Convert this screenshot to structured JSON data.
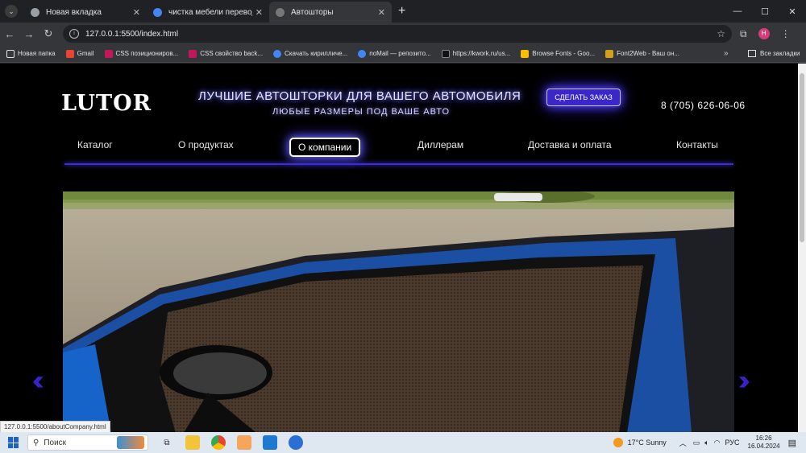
{
  "browser": {
    "tabs": [
      {
        "title": "Новая вкладка",
        "fav_color": "#aaaaaa",
        "active": false
      },
      {
        "title": "чистка мебели перевод - Пои",
        "fav_color": "#4285f4",
        "active": false
      },
      {
        "title": "Автошторы",
        "fav_color": "#777777",
        "active": true
      }
    ],
    "url": "127.0.0.1:5500/index.html",
    "profile_initial": "Н",
    "bookmarks": [
      {
        "label": "Новая папка",
        "color": "#e3e3e3"
      },
      {
        "label": "Gmail",
        "color": "#ea4335"
      },
      {
        "label": "CSS позициониров...",
        "color": "#c2185b"
      },
      {
        "label": "CSS свойство back...",
        "color": "#c2185b"
      },
      {
        "label": "Скачать кирилличе...",
        "color": "#4285f4"
      },
      {
        "label": "noMail — репозито...",
        "color": "#4285f4"
      },
      {
        "label": "https://kwork.ru/us...",
        "color": "#222222"
      },
      {
        "label": "Browse Fonts - Goo...",
        "color": "#fbbc04"
      },
      {
        "label": "Font2Web - Ваш он...",
        "color": "#d4a017"
      }
    ],
    "all_bookmarks": "Все закладки",
    "status_url": "127.0.0.1:5500/aboutCompany.html"
  },
  "site": {
    "logo": "LUTOR",
    "slogan_main": "ЛУЧШИЕ АВТОШТОРКИ ДЛЯ ВАШЕГО АВТОМОБИЛЯ",
    "slogan_sub": "ЛЮБЫЕ РАЗМЕРЫ ПОД ВАШЕ АВТО",
    "order_button": "СДЕЛАТЬ ЗАКАЗ",
    "phone": "8 (705) 626-06-06",
    "menu": [
      {
        "label": "Каталог",
        "active": false
      },
      {
        "label": "О продуктах",
        "active": false
      },
      {
        "label": "О компании",
        "active": true
      },
      {
        "label": "Диллерам",
        "active": false
      },
      {
        "label": "Доставка и оплата",
        "active": false
      },
      {
        "label": "Контакты",
        "active": false
      }
    ],
    "slider_prev": "‹‹",
    "slider_next": "››"
  },
  "taskbar": {
    "search_label": "Поиск",
    "weather": "17°C  Sunny",
    "lang": "РУС",
    "time": "16:26",
    "date": "16.04.2024"
  }
}
